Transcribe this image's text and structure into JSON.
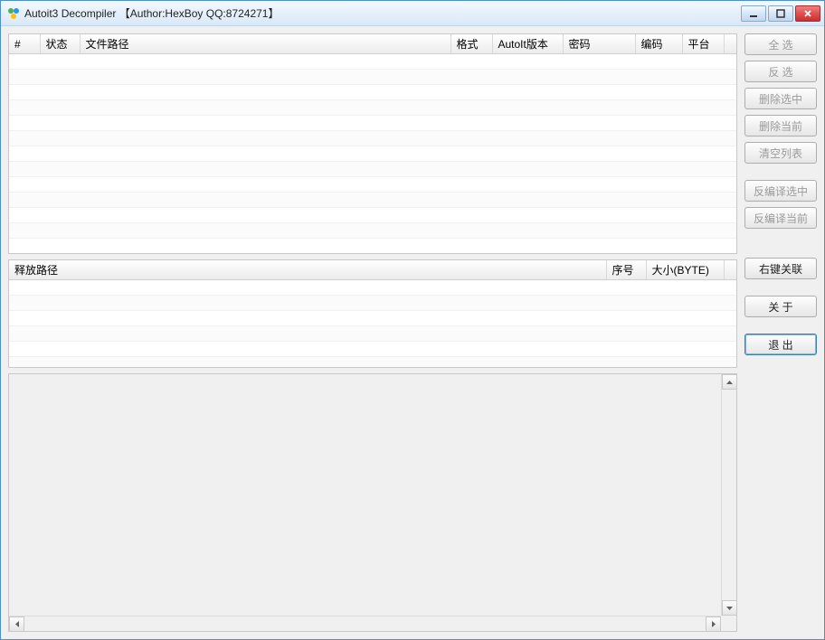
{
  "window": {
    "title": "Autoit3 Decompiler 【Author:HexBoy  QQ:8724271】"
  },
  "top_table": {
    "columns": {
      "idx": "#",
      "status": "状态",
      "path": "文件路径",
      "format": "格式",
      "version": "AutoIt版本",
      "password": "密码",
      "encoding": "编码",
      "platform": "平台"
    }
  },
  "mid_table": {
    "columns": {
      "release_path": "释放路径",
      "index": "序号",
      "size": "大小(BYTE)"
    }
  },
  "buttons": {
    "select_all": "全  选",
    "invert": "反  选",
    "delete_selected": "删除选中",
    "delete_current": "删除当前",
    "clear_list": "清空列表",
    "decompile_selected": "反编译选中",
    "decompile_current": "反编译当前",
    "associate": "右键关联",
    "about": "关  于",
    "exit": "退  出"
  }
}
